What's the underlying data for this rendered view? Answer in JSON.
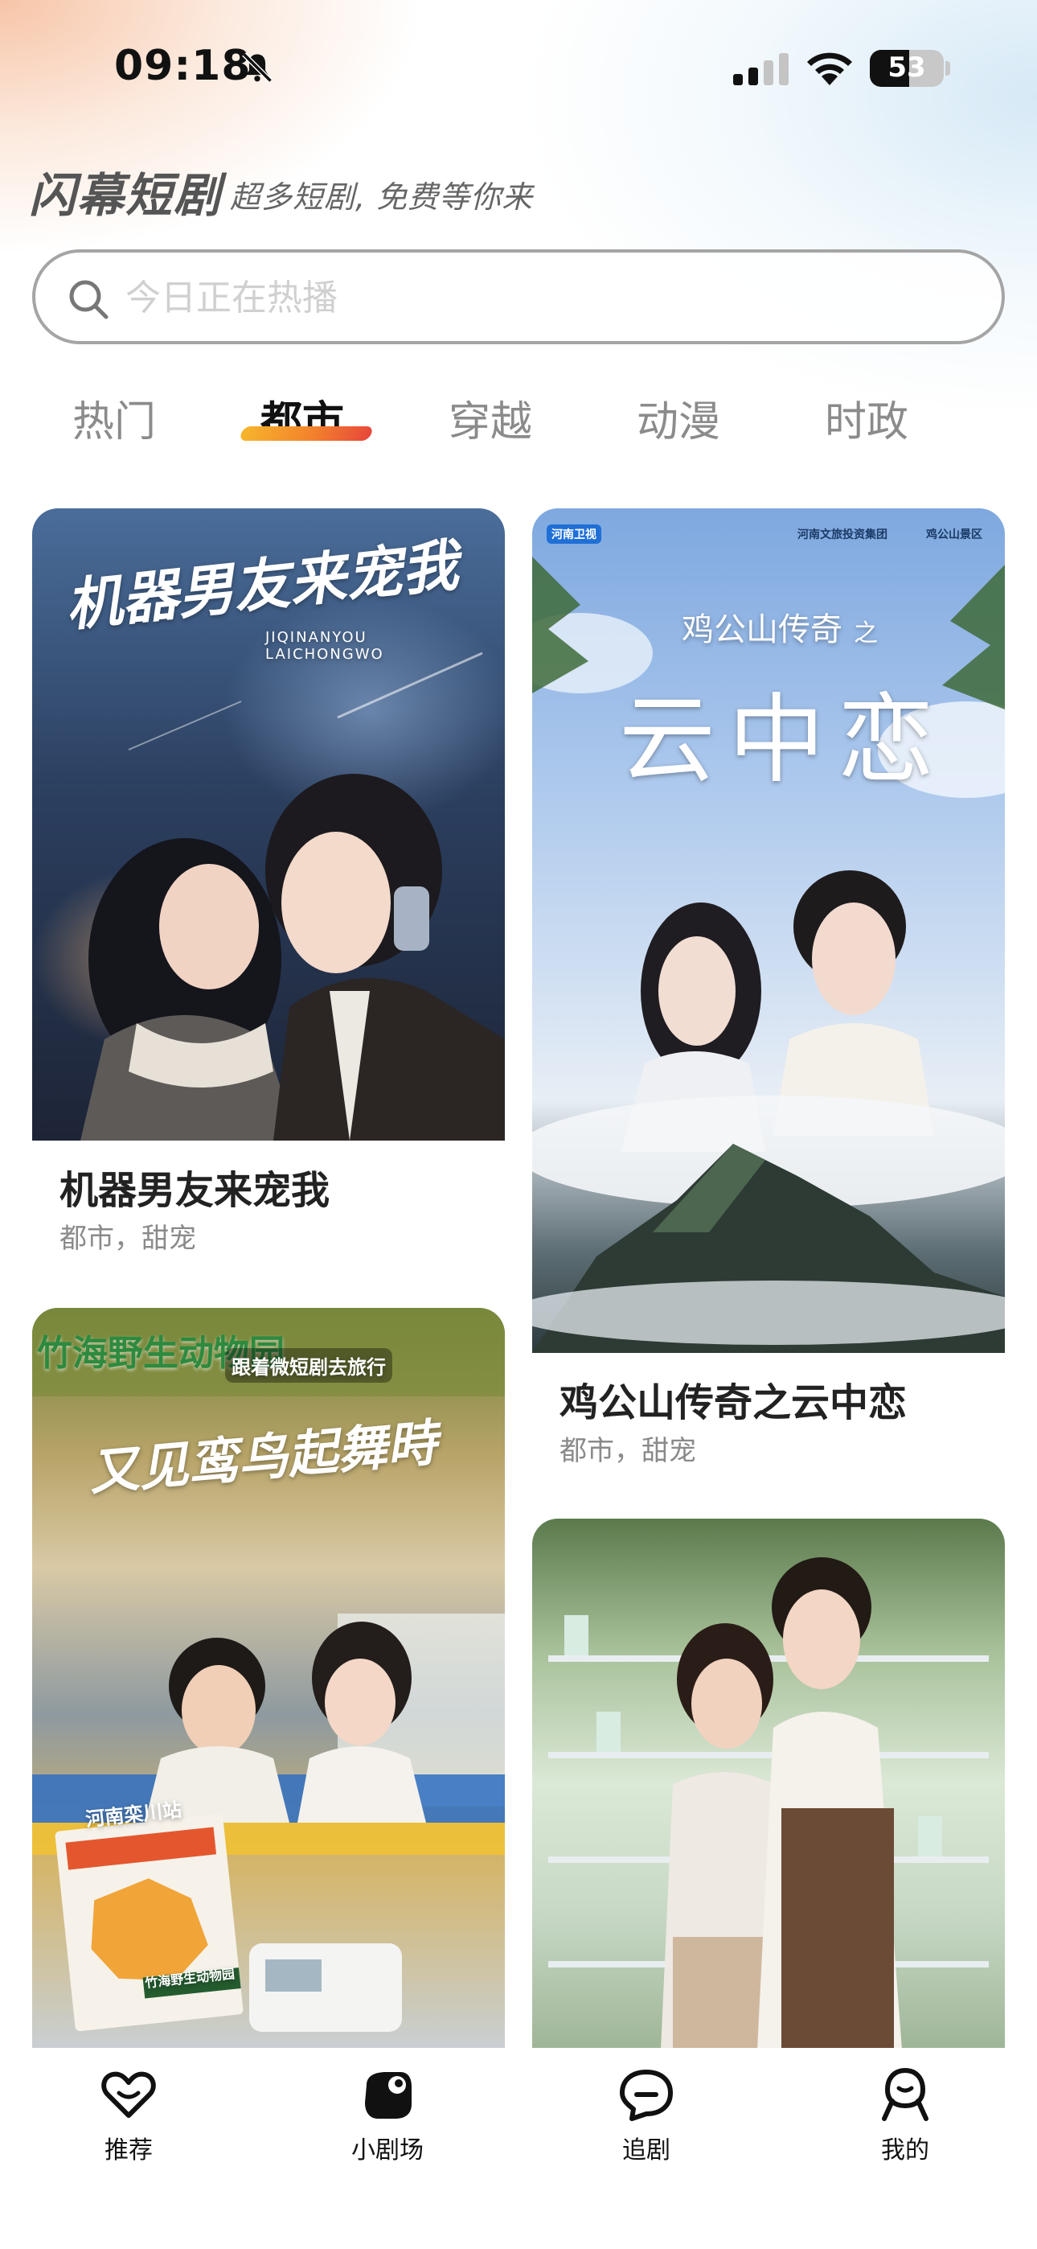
{
  "status_bar": {
    "time": "09:18",
    "battery": "53",
    "battery_level": 0.53
  },
  "brand": {
    "title": "闪幕短剧",
    "slogan": "超多短剧, 免费等你来"
  },
  "search": {
    "placeholder": "今日正在热播"
  },
  "tabs": [
    {
      "label": "热门"
    },
    {
      "label": "都市",
      "active": true
    },
    {
      "label": "穿越"
    },
    {
      "label": "动漫"
    },
    {
      "label": "时政"
    }
  ],
  "cards": [
    {
      "title": "机器男友来宠我",
      "tags": "都市，甜宠",
      "poster_title": "机器男友来宠我",
      "poster_subtitle": "JIQINANYOU LAICHONGWO"
    },
    {
      "title": "鸡公山传奇之云中恋",
      "tags": "都市，甜宠",
      "poster_title": "云中恋",
      "poster_subtitle": "鸡公山传奇",
      "poster_sub_suffix": "之",
      "poster_badge_left": "河南卫视",
      "poster_badge_right": "河南文旅投资集团",
      "poster_badge_right2": "鸡公山景区"
    },
    {
      "title": "",
      "tags": "",
      "poster_title": "又见鸾鸟起舞時",
      "poster_banner": "竹海野生动物园",
      "poster_tag": "跟着微短剧去旅行",
      "poster_station": "河南栾川站",
      "poster_map_label": "竹海野生动物园"
    },
    {
      "title": "",
      "tags": ""
    }
  ],
  "bottom_nav": [
    {
      "label": "推荐",
      "icon": "heart-smile-icon"
    },
    {
      "label": "小剧场",
      "icon": "theater-blob-icon"
    },
    {
      "label": "追剧",
      "icon": "chat-bubble-icon"
    },
    {
      "label": "我的",
      "icon": "profile-icon"
    }
  ],
  "colors": {
    "accent_orange": "#f3822c",
    "accent_red": "#e8473b",
    "accent_yellow": "#f7b52c"
  }
}
